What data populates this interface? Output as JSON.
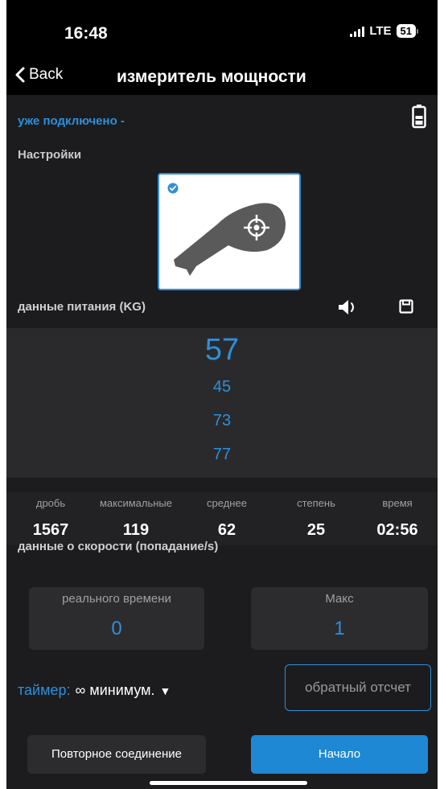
{
  "status_bar": {
    "time": "16:48",
    "network": "LTE",
    "battery": "51"
  },
  "nav": {
    "back_label": "Back",
    "title": "измеритель мощности"
  },
  "connection": {
    "status": "уже подключено -"
  },
  "settings_label": "Настройки",
  "power_section": {
    "title": "данные питания (KG)",
    "picker_values": [
      "57",
      "45",
      "73",
      "77"
    ]
  },
  "stats": [
    {
      "label": "дробь",
      "value": "1567"
    },
    {
      "label": "максимальные",
      "value": "119"
    },
    {
      "label": "среднее",
      "value": "62"
    },
    {
      "label": "степень",
      "value": "25"
    },
    {
      "label": "время",
      "value": "02:56"
    }
  ],
  "speed_section": {
    "title": "данные о скорости (попадание/s)",
    "realtime_label": "реального времени",
    "realtime_value": "0",
    "max_label": "Макс",
    "max_value": "1"
  },
  "timer": {
    "label": "таймер:",
    "value": "∞ минимум.",
    "arrow": "▼"
  },
  "countdown_label": "обратный отсчет",
  "buttons": {
    "reconnect": "Повторное соединение",
    "start": "Начало"
  },
  "colors": {
    "accent": "#2f8fda",
    "background": "#1c1c1e",
    "start_button": "#1e88d4"
  }
}
